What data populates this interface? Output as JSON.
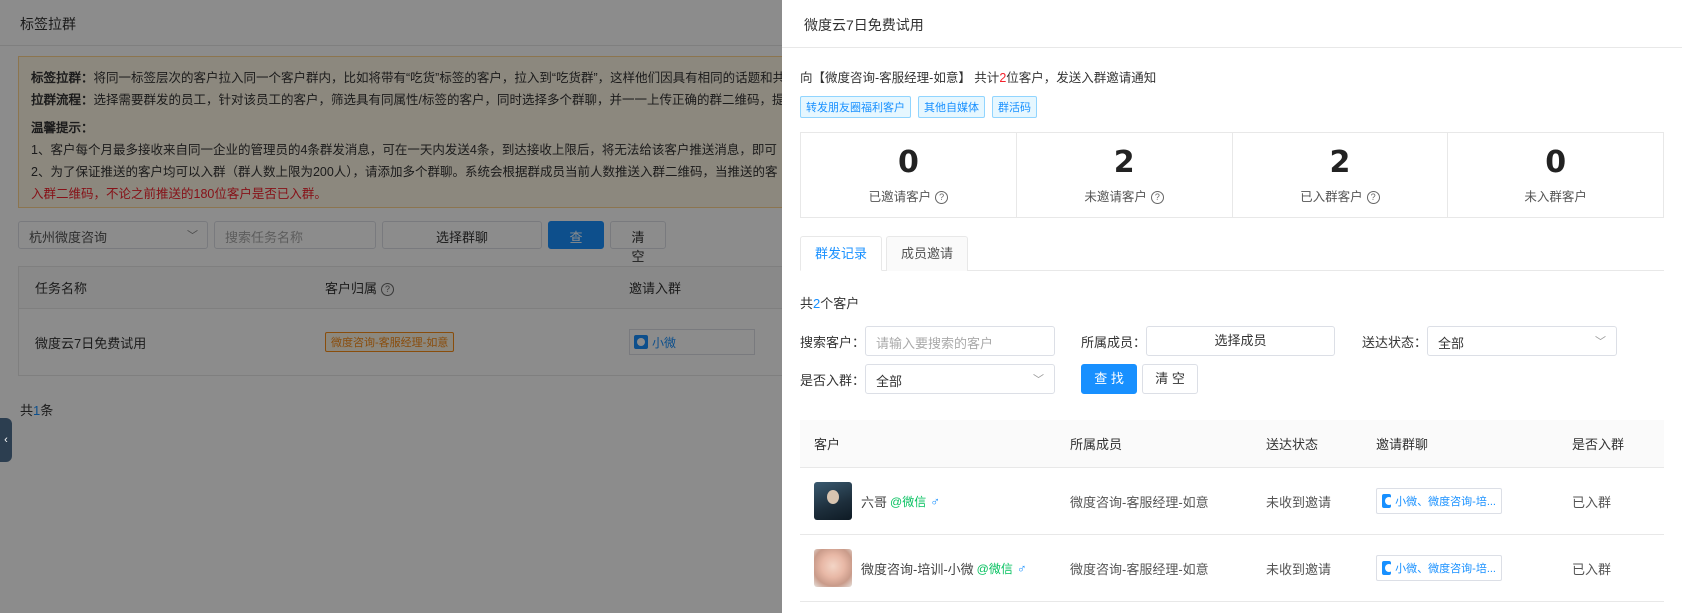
{
  "bg": {
    "title": "标签拉群",
    "tips": {
      "line1_bold": "标签拉群：",
      "line1": "将同一标签层次的客户拉入同一个客户群内，比如将带有“吃货”标签的客户，拉入到“吃货群”，这样他们因具有相同的话题和共",
      "line2_bold": "拉群流程：",
      "line2": "选择需要群发的员工，针对该员工的客户，筛选具有同属性/标签的客户，同时选择多个群聊，并一一上传正确的群二维码，提",
      "heading": "温馨提示：",
      "item1": "1、客户每个月最多接收来自同一企业的管理员的4条群发消息，可在一天内发送4条，到达接收上限后，将无法给该客户推送消息，即可",
      "item2": "2、为了保证推送的客户均可以入群（群人数上限为200人），请添加多个群聊。系统会根据群成员当前人数推送入群二维码，当推送的客",
      "item3": "入群二维码，不论之前推送的180位客户是否已入群。"
    },
    "filters": {
      "company": "杭州微度咨询",
      "task_placeholder": "搜索任务名称",
      "choose_group": "选择群聊",
      "search": "查 找",
      "clear": "清 空"
    },
    "table": {
      "headers": [
        "任务名称",
        "客户归属",
        "邀请入群"
      ],
      "row": {
        "task": "微度云7日免费试用",
        "owner": "微度咨询-客服经理-如意",
        "group": "小微"
      }
    },
    "total_prefix": "共",
    "total_num": "1",
    "total_suffix": "条"
  },
  "drawer": {
    "title": "微度云7日免费试用",
    "invite": {
      "prefix": "向【微度咨询-客服经理-如意】 共计",
      "count": "2",
      "suffix": "位客户，发送入群邀请通知"
    },
    "tags": [
      "转发朋友圈福利客户",
      "其他自媒体",
      "群活码"
    ],
    "stats": [
      {
        "value": "0",
        "label": "已邀请客户",
        "help": true
      },
      {
        "value": "2",
        "label": "未邀请客户",
        "help": true
      },
      {
        "value": "2",
        "label": "已入群客户",
        "help": true
      },
      {
        "value": "0",
        "label": "未入群客户",
        "help": false
      }
    ],
    "tabs": [
      "群发记录",
      "成员邀请"
    ],
    "total_prefix": "共",
    "total_num": "2",
    "total_suffix": "个客户",
    "form": {
      "customer_label": "搜索客户：",
      "customer_placeholder": "请输入要搜索的客户",
      "member_label": "所属成员：",
      "member_button": "选择成员",
      "status_label": "送达状态：",
      "status_value": "全部",
      "joined_label": "是否入群：",
      "joined_value": "全部",
      "search": "查 找",
      "clear": "清 空"
    },
    "table": {
      "headers": [
        "客户",
        "所属成员",
        "送达状态",
        "邀请群聊",
        "是否入群"
      ],
      "rows": [
        {
          "name": "六哥",
          "source": "@微信",
          "gender": "♂",
          "member": "微度咨询-客服经理-如意",
          "status": "未收到邀请",
          "group": "小微、微度咨询-培...",
          "joined": "已入群"
        },
        {
          "name": "微度咨询-培训-小微",
          "source": "@微信",
          "gender": "♂",
          "member": "微度咨询-客服经理-如意",
          "status": "未收到邀请",
          "group": "小微、微度咨询-培...",
          "joined": "已入群"
        }
      ]
    }
  }
}
